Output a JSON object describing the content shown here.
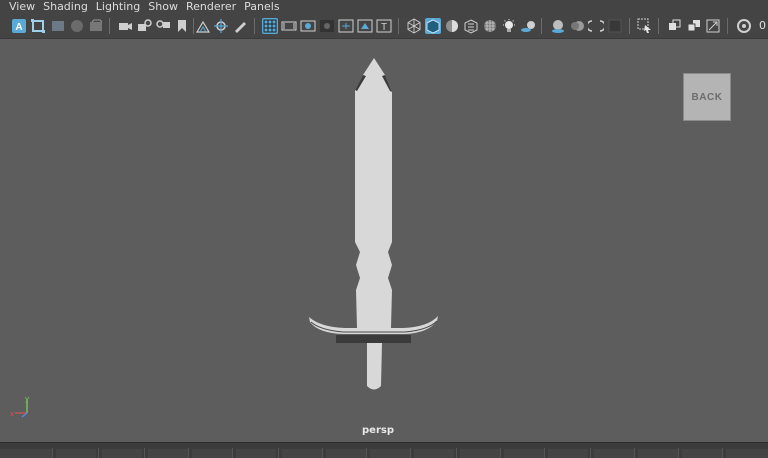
{
  "menu": {
    "items": [
      {
        "label": "View"
      },
      {
        "label": "Shading"
      },
      {
        "label": "Lighting"
      },
      {
        "label": "Show"
      },
      {
        "label": "Renderer"
      },
      {
        "label": "Panels"
      }
    ]
  },
  "toolbar": {
    "field_value": "0"
  },
  "viewport": {
    "camera_label": "persp",
    "viewcube_label": "BACK",
    "axis": {
      "x": "x",
      "y": "y",
      "z": "z"
    }
  },
  "colors": {
    "toolbar_bg": "#444444",
    "viewport_bg": "#5d5d5d",
    "active_icon": "#5aa9d6",
    "model_light": "#d8d8d8",
    "model_dark": "#3b3b3b"
  }
}
